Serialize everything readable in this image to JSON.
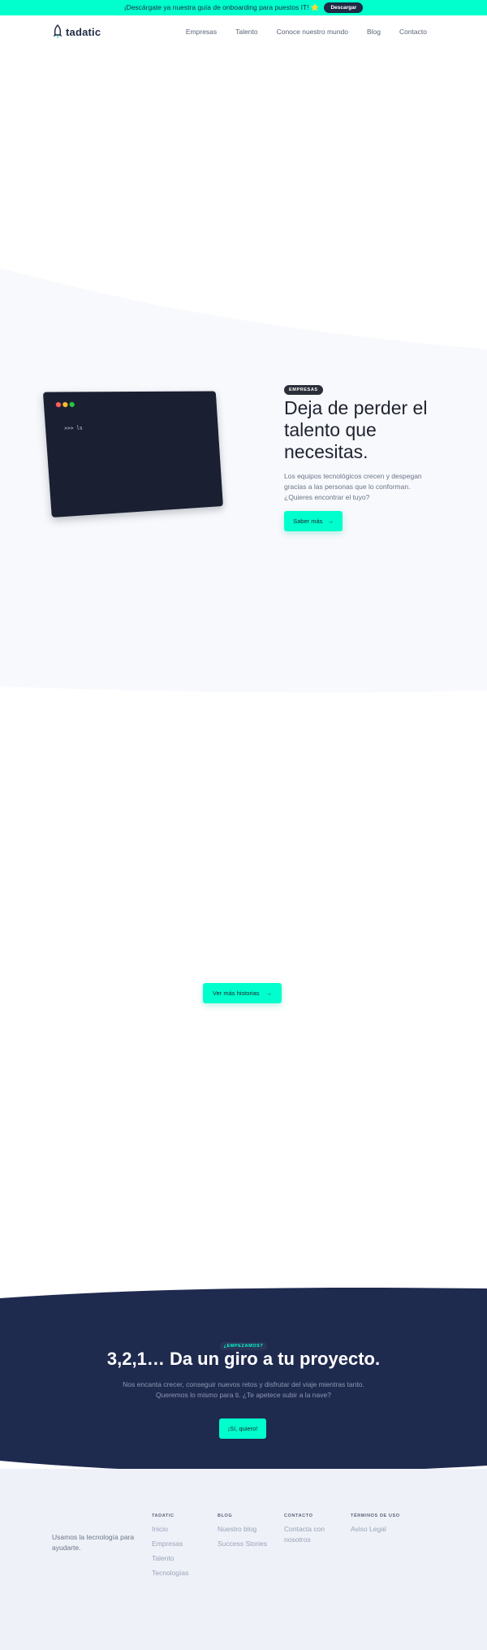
{
  "announcement": {
    "text": "¡Descárgate ya nuestra guía de onboarding para puestos IT! ⭐",
    "button_label": "Descargar"
  },
  "header": {
    "logo_text": "tadatic",
    "nav": [
      "Empresas",
      "Talento",
      "Conoce nuestro mundo",
      "Blog",
      "Contacto"
    ]
  },
  "hero": {
    "badge": "EMPRESAS",
    "title": "Deja de perder el talento que necesitas.",
    "description": "Los equipos tecnológicos crecen y despegan gracias a las personas que lo conforman. ¿Quieres encontrar el tuyo?",
    "button_label": "Saber más",
    "terminal_text": ">>> ls"
  },
  "stories": {
    "button_label": "Ver más historias"
  },
  "cta": {
    "badge": "¿EMPEZAMOS?",
    "title": "3,2,1… Da un giro a tu proyecto.",
    "description": "Nos encanta crecer, conseguir nuevos retos y disfrutar del viaje mientras tanto. Queremos lo mismo para ti. ¿Te apetece subir a la nave?",
    "button_label": "¡Sí, quiero!"
  },
  "footer": {
    "tagline": "Usamos la tecnología para ayudarte.",
    "columns": [
      {
        "title": "TADATIC",
        "links": [
          "Inicio",
          "Empresas",
          "Talento",
          "Tecnologías"
        ]
      },
      {
        "title": "BLOG",
        "links": [
          "Nuestro blog",
          "Success Stories"
        ]
      },
      {
        "title": "CONTACTO",
        "links": [
          "Contacta con nosotros"
        ]
      },
      {
        "title": "TÉRMINOS DE USO",
        "links": [
          "Aviso Legal"
        ]
      }
    ]
  },
  "colors": {
    "accent": "#00ffcc",
    "dark_navy": "#1f2a4f",
    "light_section": "#f7f9fc",
    "footer_bg": "#eef1f8"
  }
}
